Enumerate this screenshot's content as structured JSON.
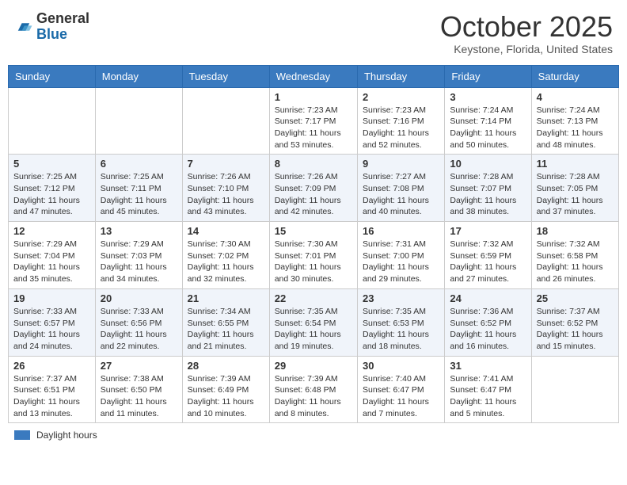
{
  "header": {
    "logo_general": "General",
    "logo_blue": "Blue",
    "month_title": "October 2025",
    "location": "Keystone, Florida, United States"
  },
  "weekdays": [
    "Sunday",
    "Monday",
    "Tuesday",
    "Wednesday",
    "Thursday",
    "Friday",
    "Saturday"
  ],
  "weeks": [
    [
      {
        "day": "",
        "content": ""
      },
      {
        "day": "",
        "content": ""
      },
      {
        "day": "",
        "content": ""
      },
      {
        "day": "1",
        "content": "Sunrise: 7:23 AM\nSunset: 7:17 PM\nDaylight: 11 hours and 53 minutes."
      },
      {
        "day": "2",
        "content": "Sunrise: 7:23 AM\nSunset: 7:16 PM\nDaylight: 11 hours and 52 minutes."
      },
      {
        "day": "3",
        "content": "Sunrise: 7:24 AM\nSunset: 7:14 PM\nDaylight: 11 hours and 50 minutes."
      },
      {
        "day": "4",
        "content": "Sunrise: 7:24 AM\nSunset: 7:13 PM\nDaylight: 11 hours and 48 minutes."
      }
    ],
    [
      {
        "day": "5",
        "content": "Sunrise: 7:25 AM\nSunset: 7:12 PM\nDaylight: 11 hours and 47 minutes."
      },
      {
        "day": "6",
        "content": "Sunrise: 7:25 AM\nSunset: 7:11 PM\nDaylight: 11 hours and 45 minutes."
      },
      {
        "day": "7",
        "content": "Sunrise: 7:26 AM\nSunset: 7:10 PM\nDaylight: 11 hours and 43 minutes."
      },
      {
        "day": "8",
        "content": "Sunrise: 7:26 AM\nSunset: 7:09 PM\nDaylight: 11 hours and 42 minutes."
      },
      {
        "day": "9",
        "content": "Sunrise: 7:27 AM\nSunset: 7:08 PM\nDaylight: 11 hours and 40 minutes."
      },
      {
        "day": "10",
        "content": "Sunrise: 7:28 AM\nSunset: 7:07 PM\nDaylight: 11 hours and 38 minutes."
      },
      {
        "day": "11",
        "content": "Sunrise: 7:28 AM\nSunset: 7:05 PM\nDaylight: 11 hours and 37 minutes."
      }
    ],
    [
      {
        "day": "12",
        "content": "Sunrise: 7:29 AM\nSunset: 7:04 PM\nDaylight: 11 hours and 35 minutes."
      },
      {
        "day": "13",
        "content": "Sunrise: 7:29 AM\nSunset: 7:03 PM\nDaylight: 11 hours and 34 minutes."
      },
      {
        "day": "14",
        "content": "Sunrise: 7:30 AM\nSunset: 7:02 PM\nDaylight: 11 hours and 32 minutes."
      },
      {
        "day": "15",
        "content": "Sunrise: 7:30 AM\nSunset: 7:01 PM\nDaylight: 11 hours and 30 minutes."
      },
      {
        "day": "16",
        "content": "Sunrise: 7:31 AM\nSunset: 7:00 PM\nDaylight: 11 hours and 29 minutes."
      },
      {
        "day": "17",
        "content": "Sunrise: 7:32 AM\nSunset: 6:59 PM\nDaylight: 11 hours and 27 minutes."
      },
      {
        "day": "18",
        "content": "Sunrise: 7:32 AM\nSunset: 6:58 PM\nDaylight: 11 hours and 26 minutes."
      }
    ],
    [
      {
        "day": "19",
        "content": "Sunrise: 7:33 AM\nSunset: 6:57 PM\nDaylight: 11 hours and 24 minutes."
      },
      {
        "day": "20",
        "content": "Sunrise: 7:33 AM\nSunset: 6:56 PM\nDaylight: 11 hours and 22 minutes."
      },
      {
        "day": "21",
        "content": "Sunrise: 7:34 AM\nSunset: 6:55 PM\nDaylight: 11 hours and 21 minutes."
      },
      {
        "day": "22",
        "content": "Sunrise: 7:35 AM\nSunset: 6:54 PM\nDaylight: 11 hours and 19 minutes."
      },
      {
        "day": "23",
        "content": "Sunrise: 7:35 AM\nSunset: 6:53 PM\nDaylight: 11 hours and 18 minutes."
      },
      {
        "day": "24",
        "content": "Sunrise: 7:36 AM\nSunset: 6:52 PM\nDaylight: 11 hours and 16 minutes."
      },
      {
        "day": "25",
        "content": "Sunrise: 7:37 AM\nSunset: 6:52 PM\nDaylight: 11 hours and 15 minutes."
      }
    ],
    [
      {
        "day": "26",
        "content": "Sunrise: 7:37 AM\nSunset: 6:51 PM\nDaylight: 11 hours and 13 minutes."
      },
      {
        "day": "27",
        "content": "Sunrise: 7:38 AM\nSunset: 6:50 PM\nDaylight: 11 hours and 11 minutes."
      },
      {
        "day": "28",
        "content": "Sunrise: 7:39 AM\nSunset: 6:49 PM\nDaylight: 11 hours and 10 minutes."
      },
      {
        "day": "29",
        "content": "Sunrise: 7:39 AM\nSunset: 6:48 PM\nDaylight: 11 hours and 8 minutes."
      },
      {
        "day": "30",
        "content": "Sunrise: 7:40 AM\nSunset: 6:47 PM\nDaylight: 11 hours and 7 minutes."
      },
      {
        "day": "31",
        "content": "Sunrise: 7:41 AM\nSunset: 6:47 PM\nDaylight: 11 hours and 5 minutes."
      },
      {
        "day": "",
        "content": ""
      }
    ]
  ],
  "legend": {
    "daylight_label": "Daylight hours"
  }
}
